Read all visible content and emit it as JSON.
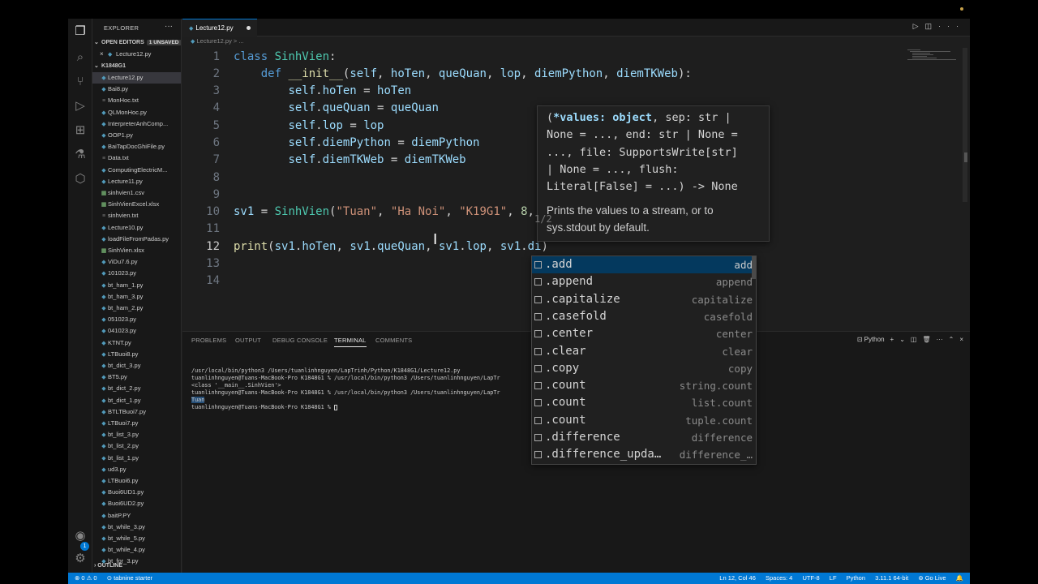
{
  "activity_bar": {
    "icons": [
      "files-icon",
      "search-icon",
      "source-control-icon",
      "run-debug-icon",
      "extensions-icon",
      "testing-icon",
      "remote-icon",
      "account-icon",
      "settings-gear-icon"
    ],
    "badge": "1"
  },
  "sidebar": {
    "title": "EXPLORER",
    "open_editors_label": "OPEN EDITORS",
    "unsaved_label": "1 UNSAVED",
    "open_editor_file": "Lecture12.py",
    "folder_label": "K1848G1",
    "files": [
      {
        "name": "Lecture12.py",
        "type": "py"
      },
      {
        "name": "Bai8.py",
        "type": "py"
      },
      {
        "name": "MonHoc.txt",
        "type": "txt"
      },
      {
        "name": "QLMonHoc.py",
        "type": "py"
      },
      {
        "name": "InterpreterAnhComp...",
        "type": "py"
      },
      {
        "name": "OOP1.py",
        "type": "py"
      },
      {
        "name": "BaiTapDocGhiFile.py",
        "type": "py"
      },
      {
        "name": "Data.txt",
        "type": "txt"
      },
      {
        "name": "ComputingElectricM...",
        "type": "py"
      },
      {
        "name": "Lecture11.py",
        "type": "py"
      },
      {
        "name": "sinhvien1.csv",
        "type": "csv"
      },
      {
        "name": "SinhVienExcel.xlsx",
        "type": "csv"
      },
      {
        "name": "sinhvien.txt",
        "type": "txt"
      },
      {
        "name": "Lecture10.py",
        "type": "py"
      },
      {
        "name": "loadFileFromPadas.py",
        "type": "py"
      },
      {
        "name": "SinhVien.xlsx",
        "type": "csv"
      },
      {
        "name": "ViDu7.6.py",
        "type": "py"
      },
      {
        "name": "101023.py",
        "type": "py"
      },
      {
        "name": "bt_ham_1.py",
        "type": "py"
      },
      {
        "name": "bt_ham_3.py",
        "type": "py"
      },
      {
        "name": "bt_ham_2.py",
        "type": "py"
      },
      {
        "name": "051023.py",
        "type": "py"
      },
      {
        "name": "041023.py",
        "type": "py"
      },
      {
        "name": "KTNT.py",
        "type": "py"
      },
      {
        "name": "LTBuoi8.py",
        "type": "py"
      },
      {
        "name": "bt_dict_3.py",
        "type": "py"
      },
      {
        "name": "BT5.py",
        "type": "py"
      },
      {
        "name": "bt_dict_2.py",
        "type": "py"
      },
      {
        "name": "bt_dict_1.py",
        "type": "py"
      },
      {
        "name": "BTLTBuoi7.py",
        "type": "py"
      },
      {
        "name": "LTBuoi7.py",
        "type": "py"
      },
      {
        "name": "bt_list_3.py",
        "type": "py"
      },
      {
        "name": "bt_list_2.py",
        "type": "py"
      },
      {
        "name": "bt_list_1.py",
        "type": "py"
      },
      {
        "name": "ud3.py",
        "type": "py"
      },
      {
        "name": "LTBuoi6.py",
        "type": "py"
      },
      {
        "name": "Buoi6UD1.py",
        "type": "py"
      },
      {
        "name": "Buoi6UD2.py",
        "type": "py"
      },
      {
        "name": "baitP.PY",
        "type": "py"
      },
      {
        "name": "bt_while_3.py",
        "type": "py"
      },
      {
        "name": "bt_while_5.py",
        "type": "py"
      },
      {
        "name": "bt_while_4.py",
        "type": "py"
      },
      {
        "name": "bt_for_3.py",
        "type": "py"
      }
    ],
    "outline_label": "OUTLINE"
  },
  "editor": {
    "tab_label": "Lecture12.py",
    "breadcrumb": "Lecture12.py > ...",
    "line_numbers": [
      "1",
      "2",
      "3",
      "4",
      "5",
      "6",
      "7",
      "8",
      "9",
      "10",
      "11",
      "12",
      "13",
      "14"
    ]
  },
  "hover": {
    "signature_lines": [
      "(*values: object, sep: str |",
      "None = ..., end: str | None =",
      "..., file: SupportsWrite[str]",
      "| None = ..., flush:",
      "Literal[False] = ...) -> None"
    ],
    "highlight": "*values: object",
    "doc": "Prints the values to a stream, or to sys.stdout by default.",
    "page": "1/2"
  },
  "suggest": {
    "items": [
      {
        "label": ".add",
        "detail": "add"
      },
      {
        "label": ".append",
        "detail": "append"
      },
      {
        "label": ".capitalize",
        "detail": "capitalize"
      },
      {
        "label": ".casefold",
        "detail": "casefold"
      },
      {
        "label": ".center",
        "detail": "center"
      },
      {
        "label": ".clear",
        "detail": "clear"
      },
      {
        "label": ".copy",
        "detail": "copy"
      },
      {
        "label": ".count",
        "detail": "string.count"
      },
      {
        "label": ".count",
        "detail": "list.count"
      },
      {
        "label": ".count",
        "detail": "tuple.count"
      },
      {
        "label": ".difference",
        "detail": "difference"
      },
      {
        "label": ".difference_upda…",
        "detail": "difference_…"
      }
    ]
  },
  "panel": {
    "tabs": [
      "PROBLEMS",
      "OUTPUT",
      "DEBUG CONSOLE",
      "TERMINAL",
      "COMMENTS"
    ],
    "active_tab": "TERMINAL",
    "shell_label": "Python",
    "terminal_lines": [
      "/usr/local/bin/python3 /Users/tuanlinhnguyen/LapTrinh/Python/K1848G1/Lecture12.py",
      "tuanlinhnguyen@Tuans-MacBook-Pro K1848G1 % /usr/local/bin/python3 /Users/tuanlinhnguyen/LapTr",
      "<class '__main__.SinhVien'>",
      "tuanlinhnguyen@Tuans-MacBook-Pro K1848G1 % /usr/local/bin/python3 /Users/tuanlinhnguyen/LapTr",
      "Tuan",
      "tuanlinhnguyen@Tuans-MacBook-Pro K1848G1 % "
    ]
  },
  "status_bar": {
    "problems": "⊗ 0 ⚠ 0",
    "tabnine": "⊙ tabnine starter",
    "cursor_pos": "Ln 12, Col 46",
    "spaces": "Spaces: 4",
    "encoding": "UTF-8",
    "eol": "LF",
    "language": "Python",
    "interpreter": "3.11.1 64-bit",
    "go_live": "⊚ Go Live",
    "bell": "🔔"
  }
}
